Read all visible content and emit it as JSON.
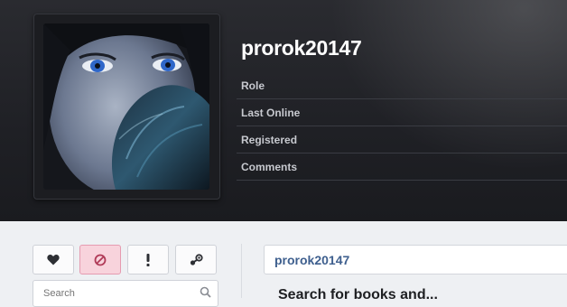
{
  "profile": {
    "username": "prorok20147",
    "info_labels": [
      "Role",
      "Last Online",
      "Registered",
      "Comments"
    ]
  },
  "actions": {
    "buttons": [
      {
        "name": "like-button",
        "icon": "heart-icon"
      },
      {
        "name": "ban-button",
        "icon": "ban-icon"
      },
      {
        "name": "report-button",
        "icon": "exclamation-icon"
      },
      {
        "name": "steam-button",
        "icon": "steam-icon"
      }
    ]
  },
  "search": {
    "placeholder": "Search"
  },
  "content": {
    "name_bar": "prorok20147",
    "heading": "Search for books and..."
  },
  "colors": {
    "header_bg": "#1f2025",
    "ban_bg": "#f8d3dc",
    "link_blue": "#3e5f8e"
  }
}
